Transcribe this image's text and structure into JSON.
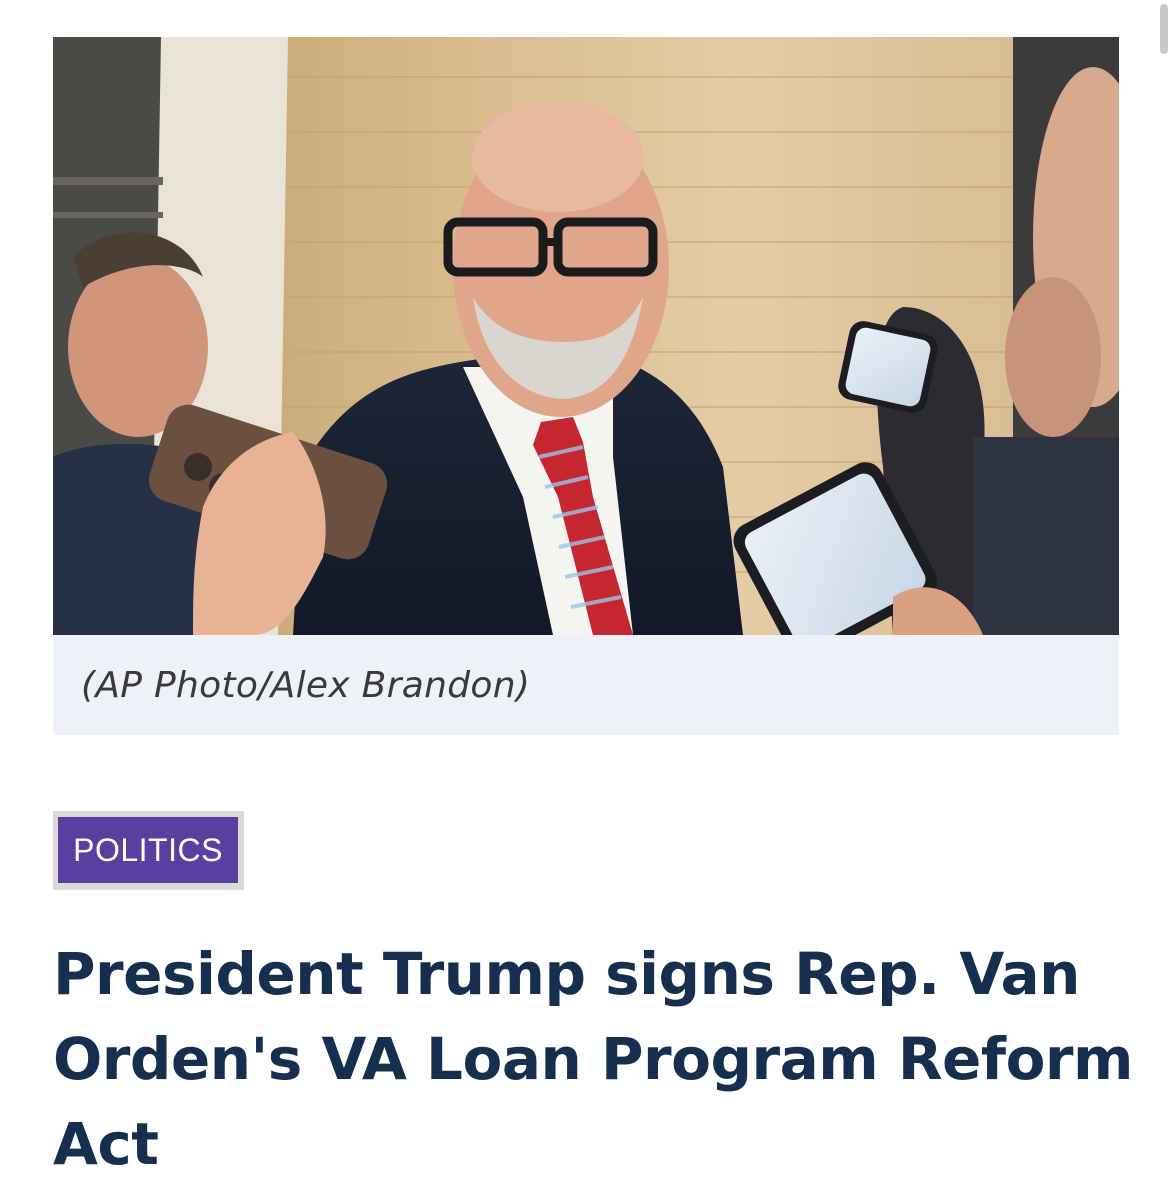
{
  "photo": {
    "caption": "(AP Photo/Alex Brandon)"
  },
  "article": {
    "category": "POLITICS",
    "headline": "President Trump signs Rep. Van Orden's VA Loan Program Reform Act"
  },
  "colors": {
    "category_background": "#5b3fa0",
    "headline_text": "#162f4e",
    "caption_background": "#eef1f8"
  }
}
